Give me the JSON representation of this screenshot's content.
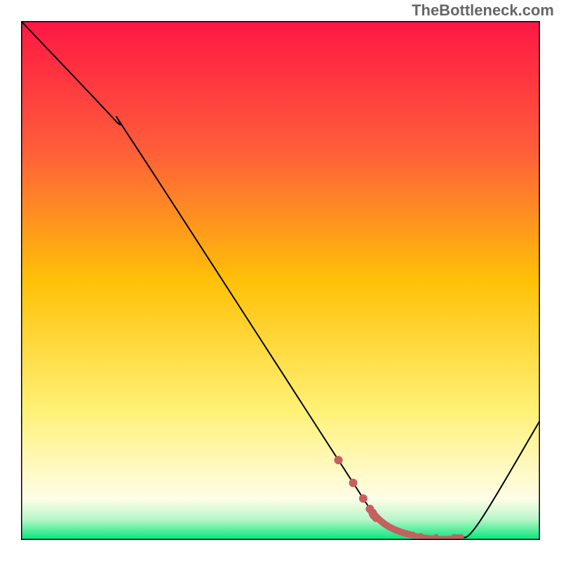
{
  "watermark": "TheBottleneck.com",
  "chart_data": {
    "type": "line",
    "title": "",
    "xlabel": "",
    "ylabel": "",
    "xlim": [
      0,
      100
    ],
    "ylim": [
      0,
      100
    ],
    "curve": [
      {
        "x": 0,
        "y": 100
      },
      {
        "x": 18,
        "y": 81
      },
      {
        "x": 22,
        "y": 76
      },
      {
        "x": 64,
        "y": 11
      },
      {
        "x": 68,
        "y": 5
      },
      {
        "x": 72,
        "y": 2
      },
      {
        "x": 78,
        "y": 0.5
      },
      {
        "x": 84,
        "y": 0.5
      },
      {
        "x": 88,
        "y": 3
      },
      {
        "x": 100,
        "y": 23
      }
    ],
    "dotted_segment": {
      "start_x": 60,
      "end_x": 85,
      "color": "#c46060"
    },
    "gradient_stops": [
      {
        "offset": 0,
        "color": "#ff1744"
      },
      {
        "offset": 25,
        "color": "#ff5e3a"
      },
      {
        "offset": 50,
        "color": "#ffc107"
      },
      {
        "offset": 75,
        "color": "#fff176"
      },
      {
        "offset": 92,
        "color": "#fffde7"
      },
      {
        "offset": 96,
        "color": "#b9f6ca"
      },
      {
        "offset": 100,
        "color": "#00e676"
      }
    ]
  }
}
